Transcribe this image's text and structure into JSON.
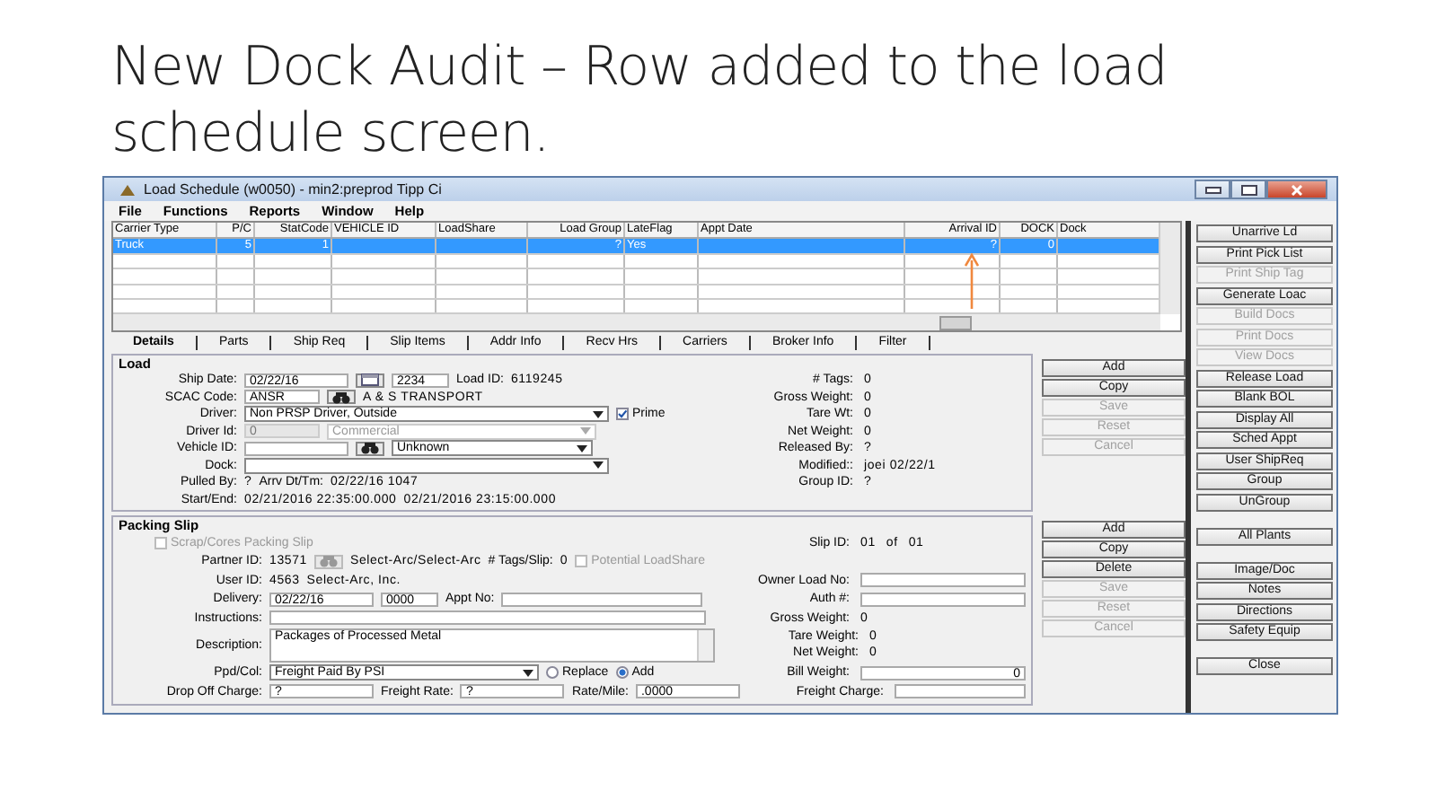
{
  "slide": {
    "title": "New Dock Audit – Row added to the load schedule screen."
  },
  "window": {
    "title": "Load Schedule (w0050) - min2:preprod Tipp Ci"
  },
  "menu": [
    "File",
    "Functions",
    "Reports",
    "Window",
    "Help"
  ],
  "table": {
    "columns": [
      "Carrier Type",
      "P/C",
      "StatCode",
      "VEHICLE ID",
      "LoadShare",
      "Load Group",
      "LateFlag",
      "Appt Date",
      "Arrival ID",
      "DOCK",
      "Dock"
    ],
    "rows": [
      {
        "selected": true,
        "cells": [
          "Truck",
          "5",
          "1",
          null,
          null,
          "?",
          "Yes",
          null,
          "?",
          "0",
          null
        ]
      }
    ]
  },
  "tabs": [
    {
      "label": "Details",
      "selected": true
    },
    {
      "label": "Parts",
      "selected": false
    },
    {
      "label": "Ship Req",
      "selected": false
    },
    {
      "label": "Slip Items",
      "selected": false
    },
    {
      "label": "Addr Info",
      "selected": false
    },
    {
      "label": "Recv Hrs",
      "selected": false
    },
    {
      "label": "Carriers",
      "selected": false
    },
    {
      "label": "Broker Info",
      "selected": false
    },
    {
      "label": "Filter",
      "selected": false
    }
  ],
  "load": {
    "title": "Load",
    "rows": [
      {
        "left": [
          {
            "kind": "label",
            "text": "Ship Date:"
          },
          {
            "kind": "field",
            "value": "02/22/16",
            "disabled": false
          },
          {
            "kind": "calendar"
          },
          {
            "kind": "field",
            "value": "2234",
            "disabled": false
          },
          {
            "kind": "label",
            "text": "Load ID:"
          },
          {
            "kind": "text",
            "text": "6119245"
          }
        ],
        "right": [
          {
            "label": "# Tags:",
            "items": [
              {
                "kind": "text",
                "text": "0"
              }
            ]
          }
        ]
      },
      {
        "left": [
          {
            "kind": "label",
            "text": "SCAC Code:"
          },
          {
            "kind": "field",
            "value": "ANSR",
            "disabled": false
          },
          {
            "kind": "find",
            "disabled": false
          },
          {
            "kind": "text",
            "text": "A & S TRANSPORT"
          }
        ],
        "right": [
          {
            "label": "Gross Weight:",
            "items": [
              {
                "kind": "text",
                "text": "0"
              }
            ]
          }
        ]
      },
      {
        "left": [
          {
            "kind": "label",
            "text": "Driver:"
          },
          {
            "kind": "dropdown",
            "value": "Non PRSP Driver, Outside",
            "disabled": false
          },
          {
            "kind": "check",
            "label": "Prime",
            "checked": true,
            "disabled": false
          }
        ],
        "right": [
          {
            "label": "Tare Wt:",
            "items": [
              {
                "kind": "text",
                "text": "0"
              }
            ]
          }
        ]
      },
      {
        "left": [
          {
            "kind": "label",
            "text": "Driver Id:"
          },
          {
            "kind": "field",
            "value": "0",
            "disabled": true
          },
          {
            "kind": "dropdown",
            "value": "Commercial",
            "disabled": true
          }
        ],
        "right": [
          {
            "label": "Net Weight:",
            "items": [
              {
                "kind": "text",
                "text": "0"
              }
            ]
          }
        ]
      },
      {
        "left": [
          {
            "kind": "label",
            "text": "Vehicle ID:"
          },
          {
            "kind": "field",
            "disabled": false
          },
          {
            "kind": "find",
            "disabled": false
          },
          {
            "kind": "dropdown",
            "value": "Unknown",
            "disabled": false
          }
        ],
        "right": [
          {
            "label": "Released By:",
            "items": [
              {
                "kind": "text",
                "text": "?"
              }
            ]
          }
        ]
      },
      {
        "left": [
          {
            "kind": "label",
            "text": "Dock:"
          },
          {
            "kind": "dropdown",
            "disabled": false
          }
        ],
        "right": [
          {
            "label": "Modified::",
            "items": [
              {
                "kind": "text",
                "text": "joei 02/22/1"
              }
            ]
          }
        ]
      },
      {
        "left": [
          {
            "kind": "label",
            "text": "Pulled By:"
          },
          {
            "kind": "text",
            "text": "?"
          },
          {
            "kind": "label",
            "text": "Arrv Dt/Tm:"
          },
          {
            "kind": "text",
            "text": "02/22/16 1047"
          }
        ],
        "right": [
          {
            "label": "Group ID:",
            "items": [
              {
                "kind": "text",
                "text": "?"
              }
            ]
          }
        ]
      },
      {
        "left": [
          {
            "kind": "label",
            "text": "Start/End:"
          },
          {
            "kind": "text",
            "text": "02/21/2016 22:35:00.000"
          },
          {
            "kind": "text",
            "text": "02/21/2016 23:15:00.000"
          }
        ]
      }
    ],
    "buttons": [
      {
        "label": "Add",
        "disabled": false
      },
      {
        "label": "Copy",
        "disabled": false
      },
      {
        "label": "Save",
        "disabled": true
      },
      {
        "label": "Reset",
        "disabled": true
      },
      {
        "label": "Cancel",
        "disabled": true
      }
    ]
  },
  "packing_slip": {
    "title": "Packing Slip",
    "rows": [
      {
        "left": [
          {
            "kind": "check",
            "label": "Scrap/Cores Packing Slip",
            "checked": false,
            "disabled": true
          }
        ],
        "right": [
          {
            "label": "Slip ID:",
            "items": [
              {
                "kind": "text",
                "text": "01"
              },
              {
                "kind": "text",
                "text": "of"
              },
              {
                "kind": "text",
                "text": "01"
              }
            ]
          }
        ]
      },
      {
        "left": [
          {
            "kind": "label",
            "text": "Partner ID:"
          },
          {
            "kind": "text",
            "text": "13571"
          },
          {
            "kind": "find",
            "disabled": true
          },
          {
            "kind": "text",
            "text": "Select-Arc/Select-Arc"
          },
          {
            "kind": "label",
            "text": "# Tags/Slip:"
          },
          {
            "kind": "text",
            "text": "0"
          },
          {
            "kind": "check",
            "label": "Potential LoadShare",
            "checked": false,
            "disabled": true
          }
        ]
      },
      {
        "left": [
          {
            "kind": "label",
            "text": "User ID:"
          },
          {
            "kind": "text",
            "text": "4563"
          },
          {
            "kind": "text",
            "text": "Select-Arc, Inc."
          }
        ],
        "right": [
          {
            "label": "Owner Load No:",
            "items": [
              {
                "kind": "field",
                "disabled": false
              }
            ]
          }
        ]
      },
      {
        "left": [
          {
            "kind": "label",
            "text": "Delivery:"
          },
          {
            "kind": "field",
            "value": "02/22/16",
            "disabled": false
          },
          {
            "kind": "field",
            "value": "0000",
            "disabled": false
          },
          {
            "kind": "label",
            "text": "Appt No:"
          },
          {
            "kind": "field",
            "disabled": false
          }
        ],
        "right": [
          {
            "label": "Auth #:",
            "items": [
              {
                "kind": "field",
                "disabled": false
              }
            ]
          }
        ]
      },
      {
        "left": [
          {
            "kind": "label",
            "text": "Instructions:"
          },
          {
            "kind": "field",
            "disabled": false
          }
        ],
        "right": [
          {
            "label": "Gross Weight:",
            "items": [
              {
                "kind": "text",
                "text": "0"
              }
            ]
          }
        ]
      },
      {
        "left": [
          {
            "kind": "label",
            "text": "Description:"
          },
          {
            "kind": "textarea",
            "value": "Packages of Processed Metal"
          }
        ],
        "right": [
          {
            "label": "Tare Weight:",
            "items": [
              {
                "kind": "text",
                "text": "0"
              }
            ]
          },
          {
            "label": "Net Weight:",
            "items": [
              {
                "kind": "text",
                "text": "0"
              }
            ]
          }
        ]
      },
      {
        "left": [
          {
            "kind": "label",
            "text": "Ppd/Col:"
          },
          {
            "kind": "dropdown",
            "value": "Freight Paid By PSI",
            "disabled": false
          },
          {
            "kind": "radio",
            "label": "Replace",
            "selected": false
          },
          {
            "kind": "radio",
            "label": "Add",
            "selected": true
          }
        ],
        "right": [
          {
            "label": "Bill Weight:",
            "items": [
              {
                "kind": "field",
                "value": "0",
                "disabled": false
              }
            ]
          }
        ]
      },
      {
        "left": [
          {
            "kind": "label",
            "text": "Drop Off Charge:"
          },
          {
            "kind": "field",
            "value": "?",
            "disabled": false
          },
          {
            "kind": "label",
            "text": "Freight Rate:"
          },
          {
            "kind": "field",
            "value": "?",
            "disabled": false
          },
          {
            "kind": "label",
            "text": "Rate/Mile:"
          },
          {
            "kind": "field",
            "value": ".0000",
            "disabled": false
          }
        ],
        "right": [
          {
            "label": "Freight Charge:",
            "items": [
              {
                "kind": "field",
                "disabled": false
              }
            ]
          }
        ]
      }
    ],
    "buttons": [
      {
        "label": "Add",
        "disabled": false
      },
      {
        "label": "Copy",
        "disabled": false
      },
      {
        "label": "Delete",
        "disabled": false
      },
      {
        "label": "Save",
        "disabled": true
      },
      {
        "label": "Reset",
        "disabled": true
      },
      {
        "label": "Cancel",
        "disabled": true
      }
    ]
  },
  "side_buttons": [
    [
      {
        "label": "Unarrive Ld",
        "disabled": false
      },
      {
        "label": "Print Pick List",
        "disabled": false
      },
      {
        "label": "Print Ship Tag",
        "disabled": true
      },
      {
        "label": "Generate Loac",
        "disabled": false
      },
      {
        "label": "Build Docs",
        "disabled": true
      },
      {
        "label": "Print Docs",
        "disabled": true
      },
      {
        "label": "View Docs",
        "disabled": true
      },
      {
        "label": "Release Load",
        "disabled": false
      },
      {
        "label": "Blank BOL",
        "disabled": false
      },
      {
        "label": "Display All",
        "disabled": false
      },
      {
        "label": "Sched Appt",
        "disabled": false
      },
      {
        "label": "User ShipReq",
        "disabled": false
      },
      {
        "label": "Group",
        "disabled": false
      },
      {
        "label": "UnGroup",
        "disabled": false
      }
    ],
    [
      {
        "label": "All Plants",
        "disabled": false
      }
    ],
    [
      {
        "label": "Image/Doc",
        "disabled": false
      },
      {
        "label": "Notes",
        "disabled": false
      },
      {
        "label": "Directions",
        "disabled": false
      },
      {
        "label": "Safety Equip",
        "disabled": false
      }
    ],
    [
      {
        "label": "Close",
        "disabled": false
      }
    ]
  ]
}
